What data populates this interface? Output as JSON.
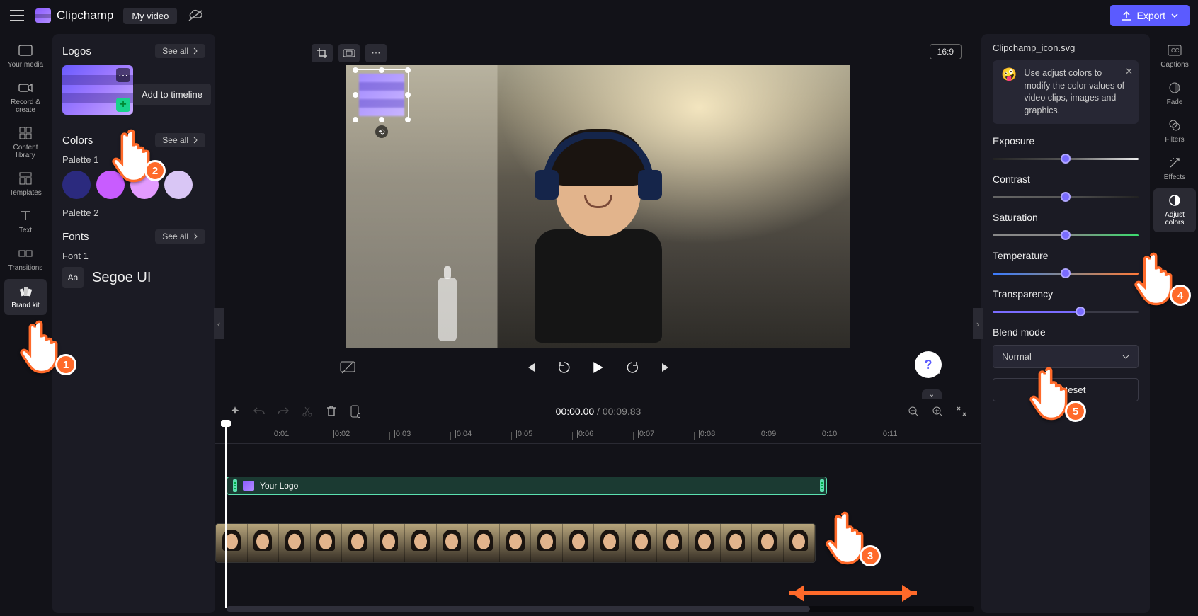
{
  "app_name": "Clipchamp",
  "project_title": "My video",
  "export_label": "Export",
  "left_rail": [
    {
      "id": "your-media",
      "label": "Your media"
    },
    {
      "id": "record-create",
      "label": "Record & create"
    },
    {
      "id": "content-library",
      "label": "Content library"
    },
    {
      "id": "templates",
      "label": "Templates"
    },
    {
      "id": "text",
      "label": "Text"
    },
    {
      "id": "transitions",
      "label": "Transitions"
    },
    {
      "id": "brand-kit",
      "label": "Brand kit"
    }
  ],
  "sidebar": {
    "logos_title": "Logos",
    "see_all": "See all",
    "add_to_timeline_tooltip": "Add to timeline",
    "colors_title": "Colors",
    "palette1_label": "Palette 1",
    "palette2_label": "Palette 2",
    "palette1": [
      "#2b2a7e",
      "#c85cff",
      "#e39bff",
      "#d9c6f5"
    ],
    "fonts_title": "Fonts",
    "font1_label": "Font 1",
    "font_preview": "Aa",
    "font_name": "Segoe UI"
  },
  "canvas": {
    "aspect_ratio": "16:9"
  },
  "timeline": {
    "current": "00:00.00",
    "total": "00:09.83",
    "ticks": [
      "|0:01",
      "|0:02",
      "|0:03",
      "|0:04",
      "|0:05",
      "|0:06",
      "|0:07",
      "|0:08",
      "|0:09",
      "|0:10",
      "|0:11"
    ],
    "logo_clip_label": "Your Logo"
  },
  "right_rail": [
    {
      "id": "captions",
      "label": "Captions"
    },
    {
      "id": "fade",
      "label": "Fade"
    },
    {
      "id": "filters",
      "label": "Filters"
    },
    {
      "id": "effects",
      "label": "Effects"
    },
    {
      "id": "adjust-colors",
      "label": "Adjust colors"
    }
  ],
  "properties": {
    "filename": "Clipchamp_icon.svg",
    "tip": "Use adjust colors to modify the color values of video clips, images and graphics.",
    "exposure": {
      "label": "Exposure",
      "value": 50
    },
    "contrast": {
      "label": "Contrast",
      "value": 50
    },
    "saturation": {
      "label": "Saturation",
      "value": 50
    },
    "temperature": {
      "label": "Temperature",
      "value": 50
    },
    "transparency": {
      "label": "Transparency",
      "value": 60
    },
    "blend_label": "Blend mode",
    "blend_value": "Normal",
    "reset_label": "Reset"
  },
  "annotations": {
    "steps": [
      "1",
      "2",
      "3",
      "4",
      "5"
    ]
  }
}
